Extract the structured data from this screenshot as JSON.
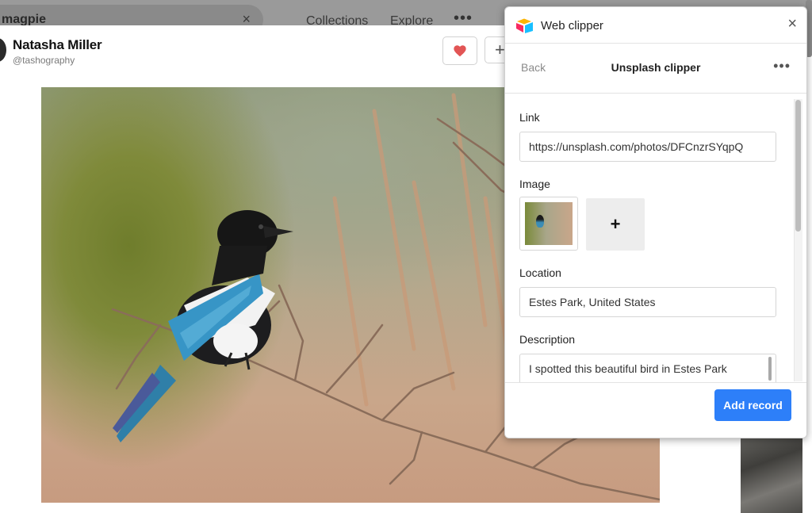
{
  "header": {
    "search_text": "magpie",
    "clear_icon": "×",
    "nav": [
      {
        "label": "Collections"
      },
      {
        "label": "Explore"
      }
    ],
    "more_icon": "•••"
  },
  "photo_page": {
    "author_name": "Natasha Miller",
    "author_handle": "@tashography",
    "heart_color": "#e25555",
    "add_label": "+"
  },
  "clipper": {
    "title": "Web clipper",
    "close_icon": "×",
    "back_label": "Back",
    "subtitle": "Unsplash clipper",
    "more_icon": "•••",
    "fields": {
      "link_label": "Link",
      "link_value": "https://unsplash.com/photos/DFCnzrSYqpQ",
      "image_label": "Image",
      "add_image_label": "+",
      "location_label": "Location",
      "location_value": "Estes Park, United States",
      "description_label": "Description",
      "description_value": "I spotted this beautiful bird in Estes Park"
    },
    "add_record_label": "Add record",
    "accent_color": "#2d7ff9"
  }
}
